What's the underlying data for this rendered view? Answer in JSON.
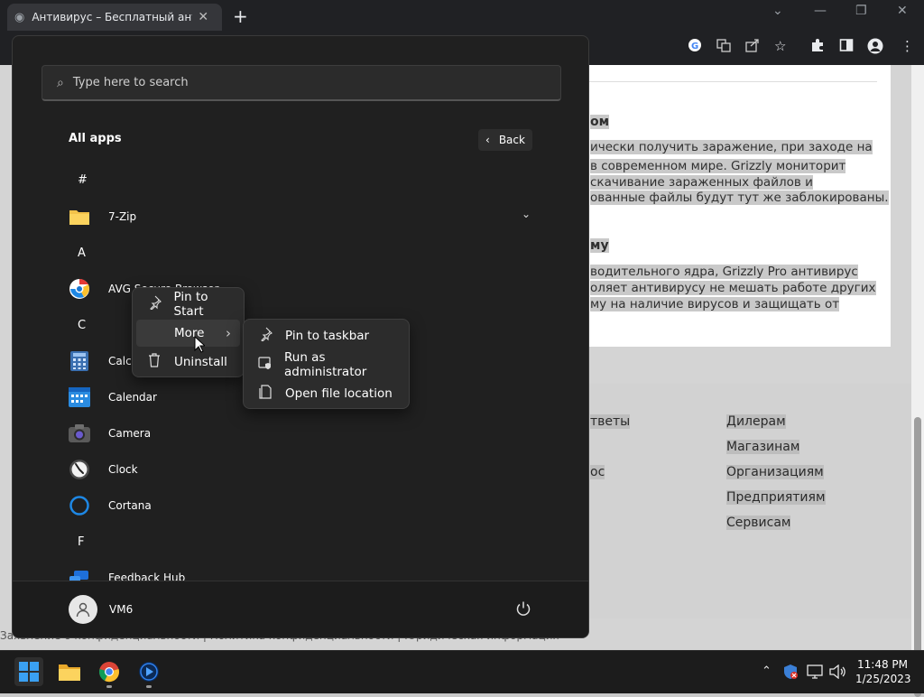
{
  "browser": {
    "tab_title": "Антивирус – Бесплатный антивирус",
    "tab_close": "✕",
    "new_tab": "+",
    "window_controls": {
      "chevron": "⌄",
      "minimize": "—",
      "restore": "❐",
      "close": "✕"
    },
    "toolbar_icons": [
      "google-icon",
      "translate-icon",
      "share-icon",
      "star-icon",
      "extensions-icon",
      "sidepanel-icon",
      "profile-icon",
      "menu-icon"
    ]
  },
  "article": {
    "heading1": "ом",
    "lines1": [
      "ически получить заражение, при заходе на",
      "в современном мире. Grizzly мониторит",
      "скачивание зараженных файлов и",
      "ованные файлы будут тут же заблокированы."
    ],
    "heading2": "му",
    "lines2": [
      "водительного ядра, Grizzly Pro антивирус",
      "оляет антивирусу не мешать работе других",
      "му на наличие вирусов и защищать от"
    ]
  },
  "footer": {
    "left_links": [
      "тветы",
      "ос"
    ],
    "right_links": [
      "Дилерам",
      "Магазинам",
      "Организациям",
      "Предприятиям",
      "Сервисам"
    ],
    "bottom_text": "Заявление о конфиденциальности   |   Политика конфиденциальности   |   Юридическая информация"
  },
  "start_menu": {
    "search_placeholder": "Type here to search",
    "all_apps_label": "All apps",
    "back_label": "Back",
    "back_chevron": "‹",
    "sections": [
      {
        "letter": "#",
        "apps": [
          {
            "name": "7-Zip",
            "icon": "folder-icon",
            "expandable": true
          }
        ]
      },
      {
        "letter": "A",
        "apps": [
          {
            "name": "AVG Secure Browser",
            "icon": "avg-browser-icon"
          }
        ]
      },
      {
        "letter": "C",
        "apps": [
          {
            "name": "Calculator",
            "icon": "calculator-icon"
          },
          {
            "name": "Calendar",
            "icon": "calendar-icon"
          },
          {
            "name": "Camera",
            "icon": "camera-icon"
          },
          {
            "name": "Clock",
            "icon": "clock-icon"
          },
          {
            "name": "Cortana",
            "icon": "cortana-icon"
          }
        ]
      },
      {
        "letter": "F",
        "apps": [
          {
            "name": "Feedback Hub",
            "icon": "feedback-hub-icon"
          }
        ]
      }
    ],
    "user_name": "VM6"
  },
  "context_menu": {
    "items": [
      {
        "label": "Pin to Start",
        "icon": "pin-icon"
      },
      {
        "label": "More",
        "icon": "",
        "submenu": true
      },
      {
        "label": "Uninstall",
        "icon": "trash-icon"
      }
    ],
    "submenu_arrow": "›"
  },
  "submenu": {
    "items": [
      {
        "label": "Pin to taskbar",
        "icon": "pin-icon"
      },
      {
        "label": "Run as administrator",
        "icon": "admin-shield-icon"
      },
      {
        "label": "Open file location",
        "icon": "file-location-icon"
      }
    ]
  },
  "taskbar": {
    "apps": [
      "start-icon",
      "file-explorer-icon",
      "chrome-icon",
      "media-player-icon"
    ],
    "time": "11:48 PM",
    "date": "1/25/2023"
  },
  "colors": {
    "start_bg": "#202020",
    "taskbar_bg": "#1c1c1c",
    "menu_bg": "#2c2c2c",
    "accent_blue": "#0078d4"
  }
}
